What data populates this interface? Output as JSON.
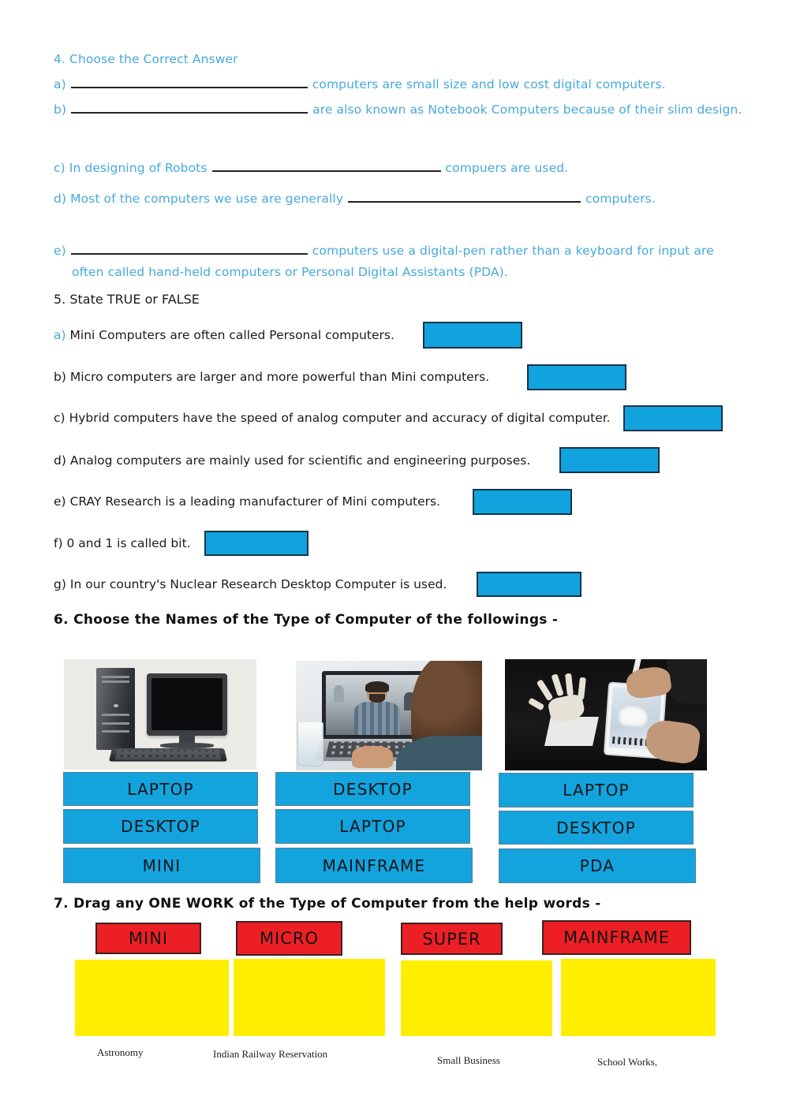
{
  "section4": {
    "heading": "4. Choose the Correct Answer",
    "items": [
      {
        "label": "a)",
        "before": "",
        "after": "computers are small size and low cost digital computers.",
        "blank_width": 300
      },
      {
        "label": "b)",
        "before": "",
        "after": "are also known as Notebook Computers because of their slim design.",
        "blank_width": 300
      },
      {
        "label": "c)",
        "before": "In designing of Robots",
        "after": "compuers are used.",
        "blank_width": 290
      },
      {
        "label": "d)",
        "before": "Most of the computers we use are generally",
        "after": "computers.",
        "blank_width": 295
      },
      {
        "label": "e)",
        "before": "",
        "after": "computers use a digital-pen rather than a keyboard for input are",
        "blank_width": 300
      }
    ],
    "item_e_second_line": "often called hand-held computers or Personal Digital Assistants (PDA)."
  },
  "section5": {
    "heading": "5. State TRUE or FALSE",
    "items": [
      {
        "label": "a)",
        "text": "Mini Computers are often called Personal computers.",
        "label_color": "#46a9dc"
      },
      {
        "label": "b)",
        "text": "Micro computers are larger and more powerful than Mini computers.",
        "label_color": "#1b1b1b"
      },
      {
        "label": "c)",
        "text": "Hybrid computers have the speed of analog computer and accuracy of digital computer.",
        "label_color": "#1b1b1b"
      },
      {
        "label": "d)",
        "text": "Analog computers are mainly used for scientific and engineering purposes.",
        "label_color": "#1b1b1b"
      },
      {
        "label": "e)",
        "text": "CRAY Research is a leading manufacturer of Mini computers.",
        "label_color": "#1b1b1b"
      },
      {
        "label": "f)",
        "text": "0 and 1 is called bit.",
        "label_color": "#1b1b1b"
      },
      {
        "label": "g)",
        "text": "In our country's Nuclear Research Desktop Computer is used.",
        "label_color": "#1b1b1b"
      }
    ],
    "answer_value": ""
  },
  "section6": {
    "heading": "6. Choose the Names of the Type of Computer of the followings -",
    "columns": [
      {
        "image_name": "desktop-computer-photo",
        "image_alt": "Desktop computer tower with monitor and keyboard",
        "options": [
          "LAPTOP",
          "DESKTOP",
          "MINI"
        ]
      },
      {
        "image_name": "laptop-video-call-photo",
        "image_alt": "Person on a video call using a laptop",
        "options": [
          "DESKTOP",
          "LAPTOP",
          "MAINFRAME"
        ]
      },
      {
        "image_name": "tablet-stylus-photo",
        "image_alt": "Hand drawing on a tablet with a stylus next to a skeletal hand model",
        "options": [
          "LAPTOP",
          "DESKTOP",
          "PDA"
        ]
      }
    ]
  },
  "section7": {
    "heading": "7. Drag any ONE WORK of the Type of Computer from the help words -",
    "cards": [
      {
        "label": "MINI",
        "drop_value": "",
        "help_word": "Astronomy"
      },
      {
        "label": "MICRO",
        "drop_value": "",
        "help_word": "Indian Railway Reservation"
      },
      {
        "label": "SUPER",
        "drop_value": "",
        "help_word": "Small Business"
      },
      {
        "label": "MAINFRAME",
        "drop_value": "",
        "help_word": "School Works,"
      }
    ]
  },
  "colors": {
    "blue_text": "#46a9dc",
    "cyan_box": "#10a3de",
    "cyan_box_border": "#16324a",
    "option_box": "#13a4dd",
    "red_label": "#ec2024",
    "yellow_drop": "#ffee00",
    "page_background": "#ffffff"
  }
}
